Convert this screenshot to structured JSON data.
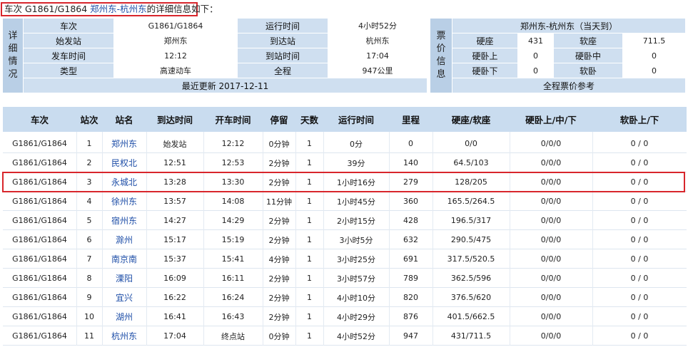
{
  "header": {
    "prefix": "车次 G1861/G1864 ",
    "route": "郑州东-杭州东",
    "suffix": "的详细信息如下："
  },
  "detail": {
    "side_label": [
      "详",
      "细",
      "情",
      "况"
    ],
    "rows": [
      {
        "l1": "车次",
        "v1": "G1861/G1864",
        "l2": "运行时间",
        "v2": "4小时52分"
      },
      {
        "l1": "始发站",
        "v1": "郑州东",
        "l2": "到达站",
        "v2": "杭州东"
      },
      {
        "l1": "发车时间",
        "v1": "12:12",
        "l2": "到站时间",
        "v2": "17:04"
      },
      {
        "l1": "类型",
        "v1": "高速动车",
        "l2": "全程",
        "v2": "947公里"
      }
    ],
    "updated": "最近更新 2017-12-11"
  },
  "fares": {
    "side_label": [
      "票",
      "价",
      "信",
      "息"
    ],
    "route_title": "郑州东-杭州东（当天到）",
    "rows": [
      {
        "l1": "硬座",
        "v1": "431",
        "l2": "软座",
        "v2": "711.5"
      },
      {
        "l1": "硬卧上",
        "v1": "0",
        "l2": "硬卧中",
        "v2": "0"
      },
      {
        "l1": "硬卧下",
        "v1": "0",
        "l2": "软卧",
        "v2": "0"
      }
    ],
    "reference": "全程票价参考"
  },
  "timetable": {
    "columns": [
      "车次",
      "站次",
      "站名",
      "到达时间",
      "开车时间",
      "停留",
      "天数",
      "运行时间",
      "里程",
      "硬座/软座",
      "硬卧上/中/下",
      "软卧上/下"
    ],
    "rows": [
      [
        "G1861/G1864",
        "1",
        "郑州东",
        "始发站",
        "12:12",
        "0分钟",
        "1",
        "0分",
        "0",
        "0/0",
        "0/0/0",
        "0 / 0"
      ],
      [
        "G1861/G1864",
        "2",
        "民权北",
        "12:51",
        "12:53",
        "2分钟",
        "1",
        "39分",
        "140",
        "64.5/103",
        "0/0/0",
        "0 / 0"
      ],
      [
        "G1861/G1864",
        "3",
        "永城北",
        "13:28",
        "13:30",
        "2分钟",
        "1",
        "1小时16分",
        "279",
        "128/205",
        "0/0/0",
        "0 / 0"
      ],
      [
        "G1861/G1864",
        "4",
        "徐州东",
        "13:57",
        "14:08",
        "11分钟",
        "1",
        "1小时45分",
        "360",
        "165.5/264.5",
        "0/0/0",
        "0 / 0"
      ],
      [
        "G1861/G1864",
        "5",
        "宿州东",
        "14:27",
        "14:29",
        "2分钟",
        "1",
        "2小时15分",
        "428",
        "196.5/317",
        "0/0/0",
        "0 / 0"
      ],
      [
        "G1861/G1864",
        "6",
        "滁州",
        "15:17",
        "15:19",
        "2分钟",
        "1",
        "3小时5分",
        "632",
        "290.5/475",
        "0/0/0",
        "0 / 0"
      ],
      [
        "G1861/G1864",
        "7",
        "南京南",
        "15:37",
        "15:41",
        "4分钟",
        "1",
        "3小时25分",
        "691",
        "317.5/520.5",
        "0/0/0",
        "0 / 0"
      ],
      [
        "G1861/G1864",
        "8",
        "溧阳",
        "16:09",
        "16:11",
        "2分钟",
        "1",
        "3小时57分",
        "789",
        "362.5/596",
        "0/0/0",
        "0 / 0"
      ],
      [
        "G1861/G1864",
        "9",
        "宜兴",
        "16:22",
        "16:24",
        "2分钟",
        "1",
        "4小时10分",
        "820",
        "376.5/620",
        "0/0/0",
        "0 / 0"
      ],
      [
        "G1861/G1864",
        "10",
        "湖州",
        "16:41",
        "16:43",
        "2分钟",
        "1",
        "4小时29分",
        "876",
        "401.5/662.5",
        "0/0/0",
        "0 / 0"
      ],
      [
        "G1861/G1864",
        "11",
        "杭州东",
        "17:04",
        "终点站",
        "0分钟",
        "1",
        "4小时52分",
        "947",
        "431/711.5",
        "0/0/0",
        "0 / 0"
      ]
    ],
    "highlighted_row": 2
  },
  "colors": {
    "label_bg": "#cfdff0",
    "side_bg": "#b9cfe6",
    "header_bg": "#c9dcef",
    "highlight": "#d8262c",
    "link": "#1f4fa8"
  }
}
